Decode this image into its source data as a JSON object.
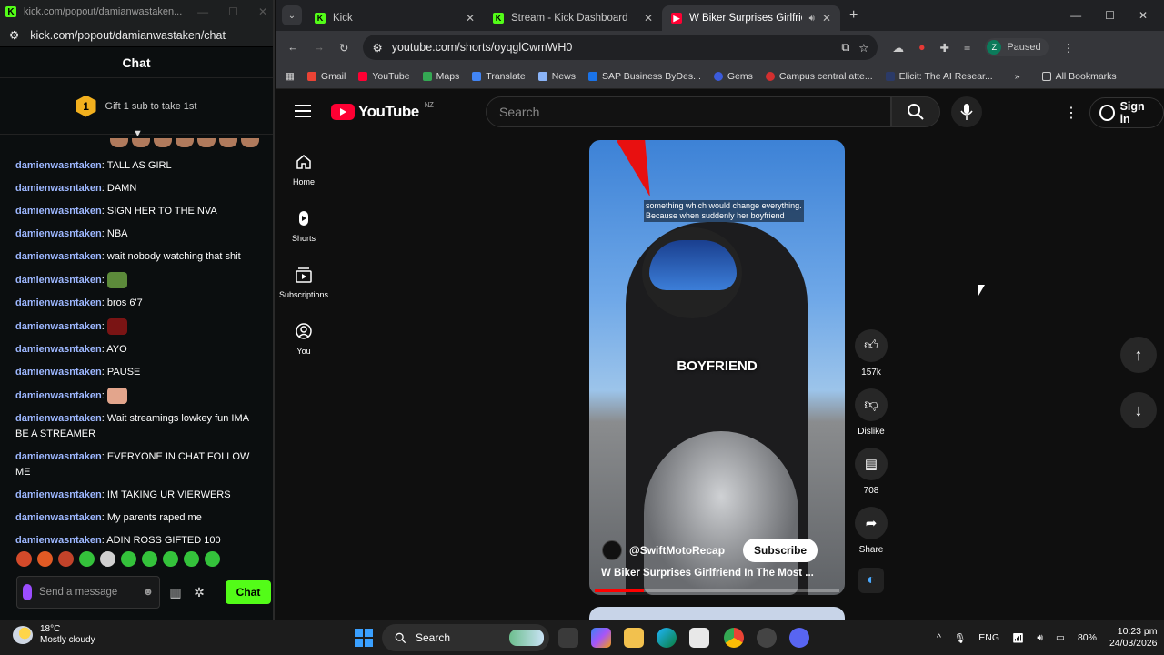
{
  "kick": {
    "window_title": "kick.com/popout/damianwastaken...",
    "url": "kick.com/popout/damianwastaken/chat",
    "header": "Chat",
    "gift_rank": "1",
    "gift_text": "Gift 1 sub to take 1st",
    "messages": [
      {
        "user": "damienwasntaken",
        "text": "TALL AS GIRL"
      },
      {
        "user": "damienwasntaken",
        "text": "DAMN"
      },
      {
        "user": "damienwasntaken",
        "text": "SIGN HER TO THE NVA"
      },
      {
        "user": "damienwasntaken",
        "text": "NBA"
      },
      {
        "user": "damienwasntaken",
        "text": "wait nobody watching that shit"
      },
      {
        "user": "damienwasntaken",
        "text": ""
      },
      {
        "user": "damienwasntaken",
        "text": "bros 6'7"
      },
      {
        "user": "damienwasntaken",
        "text": ""
      },
      {
        "user": "damienwasntaken",
        "text": "AYO"
      },
      {
        "user": "damienwasntaken",
        "text": "PAUSE"
      },
      {
        "user": "damienwasntaken",
        "text": ""
      },
      {
        "user": "damienwasntaken",
        "text": "Wait streamings lowkey fun IMA BE A STREAMER"
      },
      {
        "user": "damienwasntaken",
        "text": "EVERYONE IN CHAT FOLLOW ME"
      },
      {
        "user": "damienwasntaken",
        "text": "IM TAKING UR VIERWERS"
      },
      {
        "user": "damienwasntaken",
        "text": "My parents raped me"
      },
      {
        "user": "damienwasntaken",
        "text": "ADIN ROSS GIFTED 100"
      }
    ],
    "input_placeholder": "Send a message",
    "chat_button": "Chat",
    "accent": "#53fc18"
  },
  "browser": {
    "tabs": [
      {
        "title": "Kick",
        "icon": "kick-icon"
      },
      {
        "title": "Stream - Kick Dashboard",
        "icon": "kick-icon"
      },
      {
        "title": "W Biker Surprises Girlfriend",
        "icon": "youtube-icon"
      }
    ],
    "url": "youtube.com/shorts/oyqglCwmWH0",
    "profile_initial": "Z",
    "profile_status": "Paused",
    "bookmarks": [
      "Gmail",
      "YouTube",
      "Maps",
      "Translate",
      "News",
      "SAP Business ByDes...",
      "Gems",
      "Campus central atte...",
      "Elicit: The AI Resear..."
    ],
    "all_bookmarks": "All Bookmarks"
  },
  "youtube": {
    "logo": "YouTube",
    "region": "NZ",
    "search_placeholder": "Search",
    "sign_in": "Sign in",
    "sidebar": [
      {
        "label": "Home",
        "icon": "home-icon"
      },
      {
        "label": "Shorts",
        "icon": "shorts-icon"
      },
      {
        "label": "Subscriptions",
        "icon": "subscriptions-icon"
      },
      {
        "label": "You",
        "icon": "user-icon"
      }
    ],
    "short": {
      "caption_line1": "something which would change everything.",
      "caption_line2": "Because when suddenly her boyfriend",
      "overlay_word": "BOYFRIEND",
      "channel": "@SwiftMotoRecap",
      "subscribe": "Subscribe",
      "title": "W Biker Surprises Girlfriend In The Most ...",
      "progress": 0.2
    },
    "actions": {
      "likes": "157k",
      "dislike": "Dislike",
      "comments": "708",
      "share": "Share"
    }
  },
  "taskbar": {
    "temp": "18°C",
    "weather": "Mostly cloudy",
    "search": "Search",
    "language": "ENG",
    "battery": "80%",
    "time": "10:23 pm",
    "date": "24/03/2026"
  }
}
